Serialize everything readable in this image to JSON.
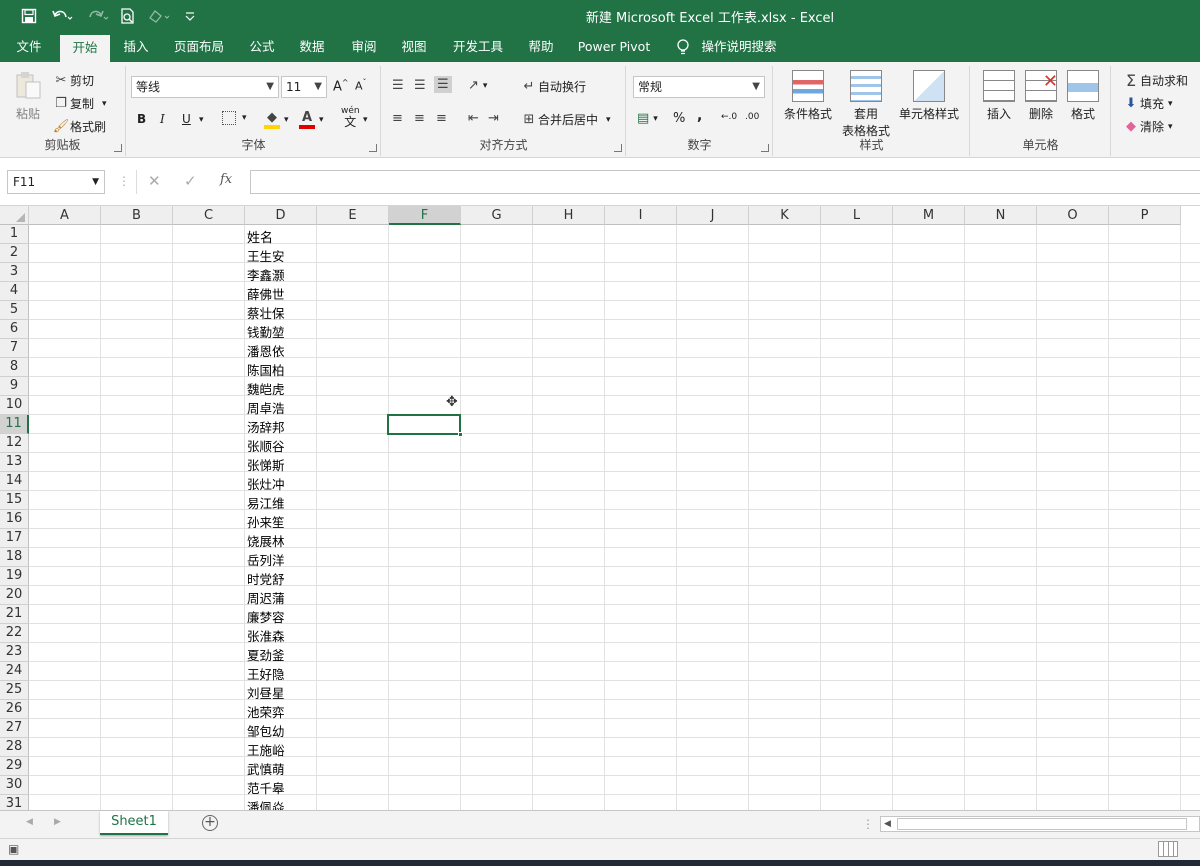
{
  "window": {
    "title": "新建 Microsoft Excel 工作表.xlsx  -  Excel"
  },
  "quick_access": {
    "save_icon": "save-icon",
    "undo_icon": "undo-icon",
    "redo_icon": "redo-icon",
    "preview_icon": "print-preview-icon",
    "customize_icon": "customize-quick-access-icon"
  },
  "tabs": [
    {
      "label": "文件"
    },
    {
      "label": "开始"
    },
    {
      "label": "插入"
    },
    {
      "label": "页面布局"
    },
    {
      "label": "公式"
    },
    {
      "label": "数据"
    },
    {
      "label": "审阅"
    },
    {
      "label": "视图"
    },
    {
      "label": "开发工具"
    },
    {
      "label": "帮助"
    },
    {
      "label": "Power Pivot"
    },
    {
      "label": "操作说明搜索"
    }
  ],
  "ribbon": {
    "clipboard": {
      "label": "剪贴板",
      "paste": "粘贴",
      "cut": "剪切",
      "copy": "复制",
      "format_painter": "格式刷"
    },
    "font": {
      "label": "字体",
      "font_name": "等线",
      "font_size": "11",
      "bold": "B",
      "italic": "I",
      "underline": "U",
      "phonetic": "wén",
      "phonetic_char": "文"
    },
    "alignment": {
      "label": "对齐方式",
      "wrap_text": "自动换行",
      "merge_center": "合并后居中"
    },
    "number": {
      "label": "数字",
      "format": "常规",
      "percent": "%",
      "comma": ",",
      "inc_decimal": ".00",
      "dec_decimal": ".0"
    },
    "styles": {
      "label": "样式",
      "conditional": "条件格式",
      "table_format_1": "套用",
      "table_format_2": "表格格式",
      "cell_styles": "单元格样式"
    },
    "cells": {
      "label": "单元格",
      "insert": "插入",
      "delete": "删除",
      "format": "格式"
    },
    "editing": {
      "autosum": "自动求和",
      "fill": "填充",
      "clear": "清除"
    }
  },
  "formula_bar": {
    "name_box": "F11",
    "fx": "fx",
    "value": ""
  },
  "grid": {
    "columns": [
      "A",
      "B",
      "C",
      "D",
      "E",
      "F",
      "G",
      "H",
      "I",
      "J",
      "K",
      "L",
      "M",
      "N",
      "O",
      "P"
    ],
    "selected_column": "F",
    "selected_row": 11,
    "rows": [
      "1",
      "2",
      "3",
      "4",
      "5",
      "6",
      "7",
      "8",
      "9",
      "10",
      "11",
      "12",
      "13",
      "14",
      "15",
      "16",
      "17",
      "18",
      "19",
      "20",
      "21",
      "22",
      "23",
      "24",
      "25",
      "26",
      "27",
      "28",
      "29",
      "30",
      "31"
    ],
    "column_d": [
      "姓名",
      "王生安",
      "李鑫灏",
      "薛佛世",
      "蔡壮保",
      "钱勤堃",
      "潘恩依",
      "陈国柏",
      "魏皑虎",
      "周卓浩",
      "汤辞邦",
      "张顺谷",
      "张悌斯",
      "张灶冲",
      "易江维",
      "孙来笙",
      "饶展林",
      "岳列洋",
      "时党舒",
      "周迟蒲",
      "廉梦容",
      "张淮森",
      "夏劲釜",
      "王好隐",
      "刘昼星",
      "池荣弈",
      "邹包幼",
      "王施峪",
      "武慎萌",
      "范千皋",
      "潘佩焱"
    ]
  },
  "sheets": {
    "active": "Sheet1",
    "add_icon": "add-sheet-icon"
  },
  "colors": {
    "accent": "#217346",
    "ribbon_bg": "#f3f3f3",
    "header_bg": "#efefef"
  }
}
